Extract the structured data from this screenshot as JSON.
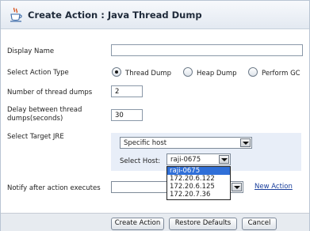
{
  "dialog": {
    "title": "Create Action : Java Thread Dump",
    "icon": "java-cup-icon"
  },
  "form": {
    "display_name": {
      "label": "Display Name",
      "value": ""
    },
    "action_type": {
      "label": "Select Action Type",
      "options": [
        "Thread Dump",
        "Heap Dump",
        "Perform GC"
      ],
      "selected": "Thread Dump"
    },
    "thread_dumps": {
      "label": "Number of thread dumps",
      "value": "2"
    },
    "delay": {
      "label_line1": "Delay between thread",
      "label_line2": "dumps(seconds)",
      "value": "30"
    },
    "target_jre": {
      "label": "Select Target JRE",
      "value": "Specific host"
    },
    "host": {
      "label": "Select Host:",
      "value": "raji-0675",
      "options": [
        "raji-0675",
        "172.20.6.122",
        "172.20.6.125",
        "172.20.7.36"
      ]
    },
    "notify": {
      "label": "Notify after action executes",
      "value": "",
      "new_action_link": "New Action"
    }
  },
  "footer": {
    "create_label": "Create Action",
    "restore_label": "Restore Defaults",
    "cancel_label": "Cancel"
  },
  "colors": {
    "title_text": "#1f2a3a",
    "target_bg": "#e8eef8",
    "selection": "#2f6fd8",
    "link": "#1a3f9c"
  }
}
